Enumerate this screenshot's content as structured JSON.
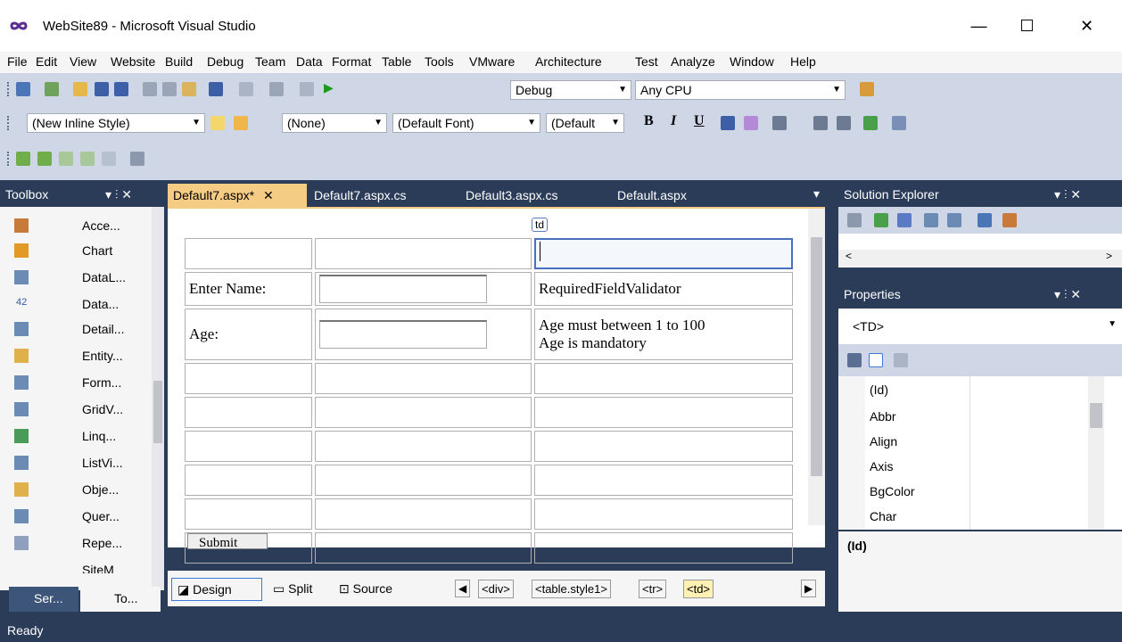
{
  "window": {
    "title": "WebSite89 - Microsoft Visual Studio",
    "minimize": "—",
    "maximize": "☐",
    "close": "✕"
  },
  "menu": [
    "File",
    "Edit",
    "View",
    "Website",
    "Build",
    "Debug",
    "Team",
    "Data",
    "Format",
    "Table",
    "Tools",
    "VMware",
    "Architecture",
    "Test",
    "Analyze",
    "Window",
    "Help"
  ],
  "toolbar1": {
    "config": "Debug",
    "platform": "Any CPU"
  },
  "toolbar2": {
    "style": "(New Inline Style)",
    "target": "(None)",
    "font": "(Default Font)",
    "size": "(Default",
    "bold": "B",
    "italic": "I",
    "underline": "U"
  },
  "toolbox": {
    "title": "Toolbox",
    "pin": "▾ ⫶ ✕",
    "items": [
      "Acce...",
      "Chart",
      "DataL...",
      "Data...",
      "Detail...",
      "Entity...",
      "Form...",
      "GridV...",
      "Linq...",
      "ListVi...",
      "Obje...",
      "Quer...",
      "Repe...",
      "SiteM"
    ],
    "tab_server": "Ser...",
    "tab_toolbox": "To..."
  },
  "tabs": [
    "Default7.aspx*",
    "Default7.aspx.cs",
    "Default3.aspx.cs",
    "Default.aspx"
  ],
  "editor": {
    "td_tag": "td",
    "rows": [
      [
        "",
        "",
        ""
      ],
      [
        "Enter Name:",
        "INPUT",
        "RequiredFieldValidator"
      ],
      [
        "Age:",
        "INPUT",
        "Age must between 1 to 100|Age is mandatory"
      ],
      [
        "",
        "",
        ""
      ],
      [
        "",
        "",
        ""
      ],
      [
        "",
        "",
        ""
      ],
      [
        "",
        "",
        ""
      ],
      [
        "",
        "",
        ""
      ],
      [
        "Submit",
        "",
        ""
      ]
    ],
    "views": {
      "design": "Design",
      "split": "Split",
      "source": "Source"
    },
    "breadcrumb": [
      "<div>",
      "<table.style1>",
      "<tr>",
      "<td>"
    ]
  },
  "solution": {
    "title": "Solution Explorer"
  },
  "properties": {
    "title": "Properties",
    "object": "<TD>",
    "selected": "(Id)",
    "items": [
      "(Id)",
      "Abbr",
      "Align",
      "Axis",
      "BgColor",
      "Char"
    ]
  },
  "status": "Ready",
  "colors": {
    "frame": "#2b3c59",
    "tab_active": "#f5cc84",
    "toolbar": "#cfd6e5"
  }
}
